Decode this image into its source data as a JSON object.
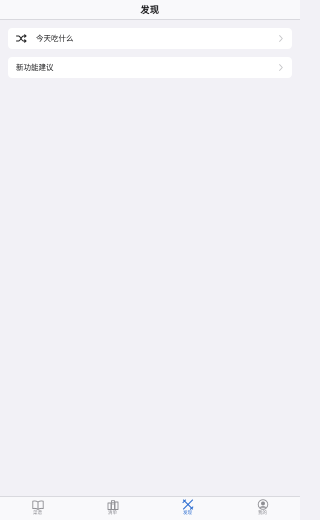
{
  "header": {
    "title": "发现"
  },
  "menu": {
    "items": [
      {
        "label": "今天吃什么",
        "icon": "shuffle-icon"
      },
      {
        "label": "新功能建议",
        "icon": null
      }
    ]
  },
  "tab_bar": {
    "active_tab": "发现",
    "tabs": [
      {
        "label": "菜谱",
        "icon": "book-icon"
      },
      {
        "label": "清单",
        "icon": "list-icon"
      },
      {
        "label": "发现",
        "icon": "tools-icon"
      },
      {
        "label": "我的",
        "icon": "profile-icon"
      }
    ]
  },
  "colors": {
    "background": "#f2f1f6",
    "accent": "#2f6fd1",
    "inactive": "#8e8e93"
  }
}
